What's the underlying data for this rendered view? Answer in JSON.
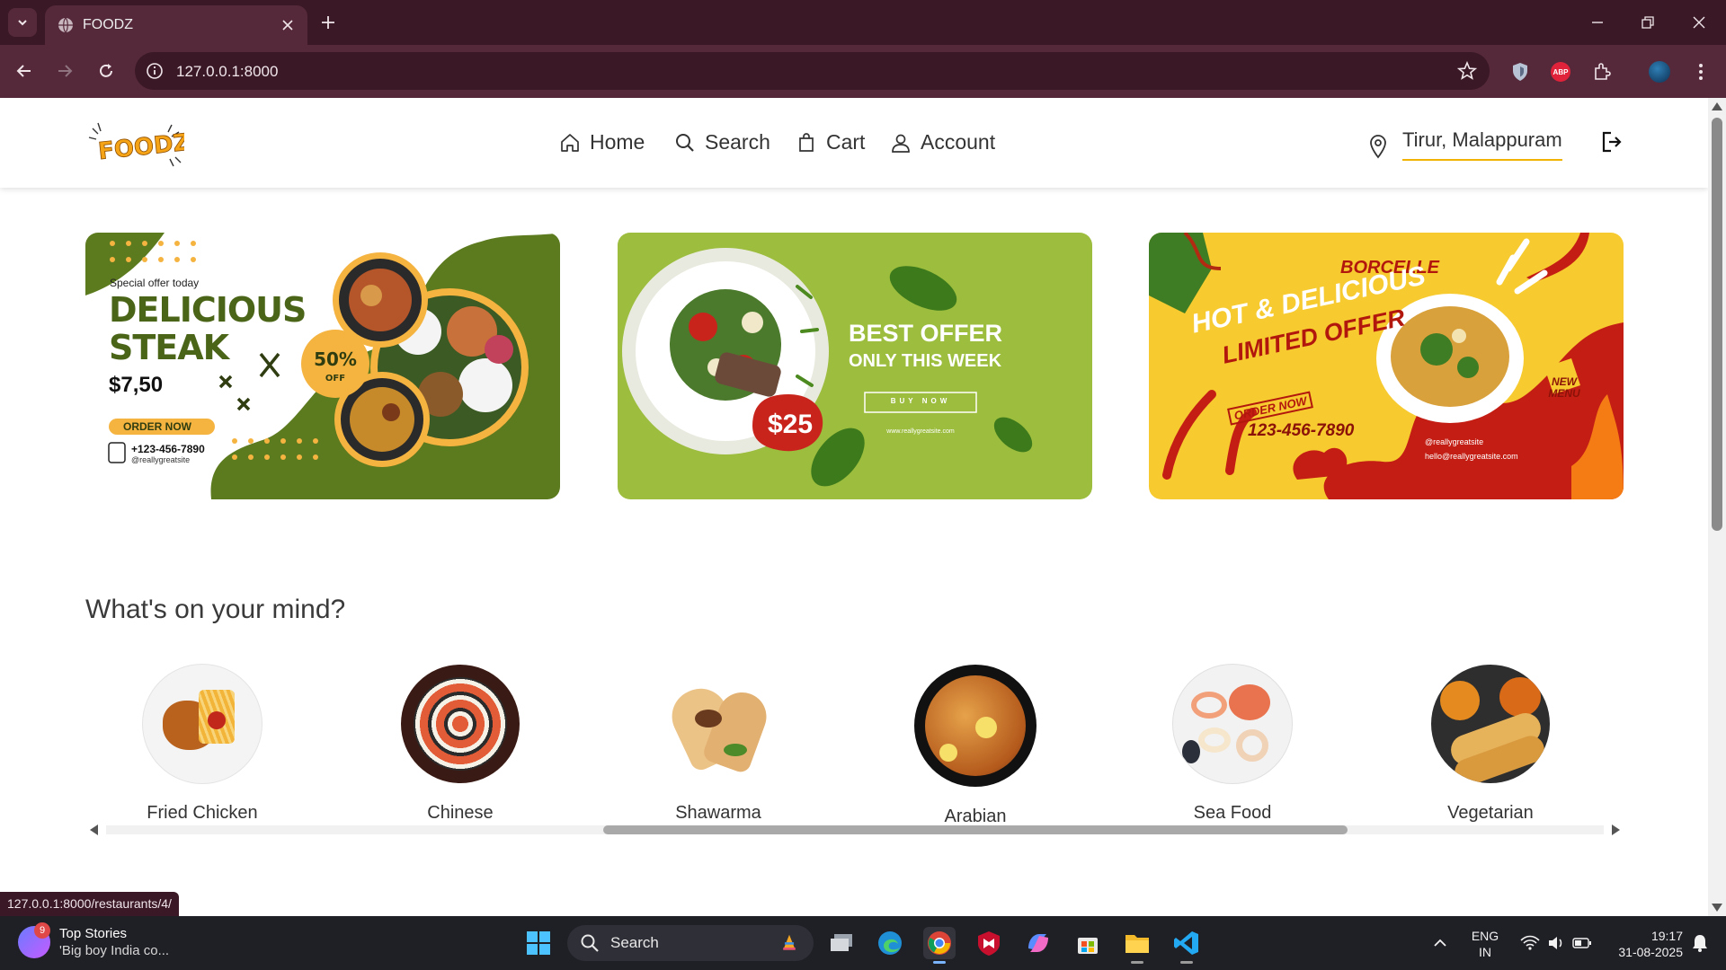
{
  "browser": {
    "tab_title": "FOODZ",
    "url": "127.0.0.1:8000",
    "status_url": "127.0.0.1:8000/restaurants/4/"
  },
  "header": {
    "logo_text": "FOODZ",
    "nav": [
      {
        "label": "Home",
        "icon": "home-icon"
      },
      {
        "label": "Search",
        "icon": "search-icon"
      },
      {
        "label": "Cart",
        "icon": "cart-icon"
      },
      {
        "label": "Account",
        "icon": "account-icon"
      }
    ],
    "location": "Tirur, Malappuram"
  },
  "banners": [
    {
      "kicker": "Special offer today",
      "title_line1": "DELICIOUS",
      "title_line2": "STEAK",
      "price": "$7,50",
      "discount": "50%",
      "discount_sub": "OFF",
      "cta": "ORDER NOW",
      "phone": "+123-456-7890",
      "handle": "@reallygreatsite"
    },
    {
      "title_line1": "BEST OFFER",
      "title_line2": "ONLY THIS WEEK",
      "cta": "BUY NOW",
      "price": "$25",
      "site": "www.reallygreatsite.com"
    },
    {
      "brand": "BORCELLE",
      "title_line1": "HOT & DELICIOUS",
      "title_line2": "LIMITED OFFER",
      "cta": "ORDER NOW",
      "phone": "123-456-7890",
      "badge": "NEW MENU",
      "social": "@reallygreatsite",
      "email": "hello@reallygreatsite.com"
    }
  ],
  "categories_title": "What's on your mind?",
  "categories": [
    {
      "label": "Fried Chicken"
    },
    {
      "label": "Chinese"
    },
    {
      "label": "Shawarma"
    },
    {
      "label": "Arabian"
    },
    {
      "label": "Sea Food"
    },
    {
      "label": "Vegetarian"
    }
  ],
  "taskbar": {
    "news_title": "Top Stories",
    "news_sub": "'Big boy India co...",
    "news_badge": "9",
    "search_placeholder": "Search",
    "lang1": "ENG",
    "lang2": "IN",
    "time": "19:17",
    "date": "31-08-2025"
  },
  "colors": {
    "chrome_dark": "#3a1826",
    "chrome_mid": "#55293a",
    "accent": "#f0b400",
    "banner_green": "#9cbd3d",
    "banner_olive": "#5c7a1e",
    "banner_yellow": "#f7cb2f"
  }
}
